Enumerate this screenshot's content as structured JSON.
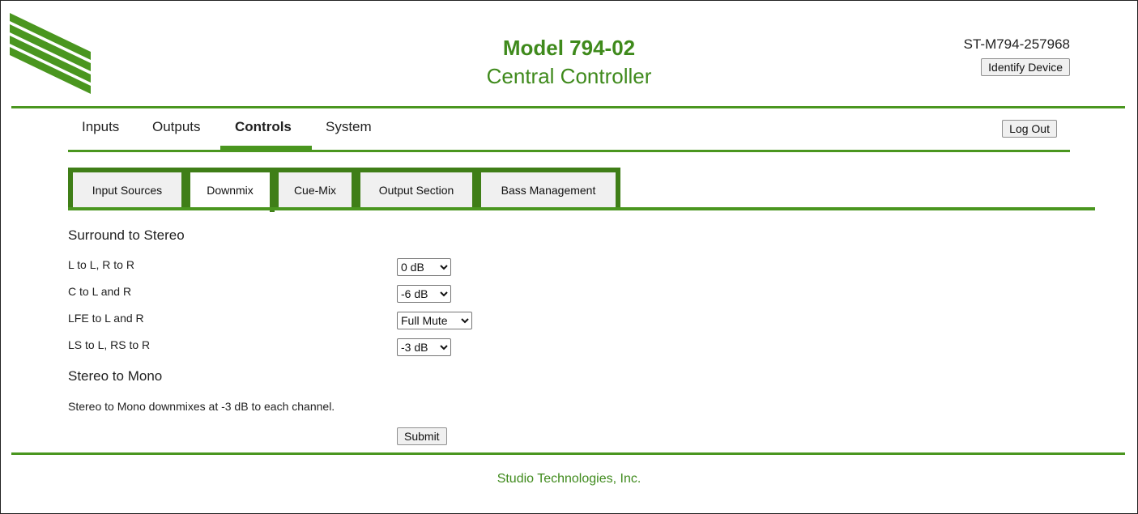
{
  "header": {
    "model": "Model 794-02",
    "subtitle": "Central Controller",
    "serial": "ST-M794-257968",
    "identify_label": "Identify Device"
  },
  "nav": {
    "items": [
      {
        "label": "Inputs"
      },
      {
        "label": "Outputs"
      },
      {
        "label": "Controls",
        "active": true
      },
      {
        "label": "System"
      }
    ],
    "logout_label": "Log Out"
  },
  "tabs": [
    {
      "label": "Input Sources"
    },
    {
      "label": "Downmix",
      "active": true
    },
    {
      "label": "Cue-Mix"
    },
    {
      "label": "Output Section"
    },
    {
      "label": "Bass Management"
    }
  ],
  "sections": {
    "surround": "Surround to Stereo",
    "mono": "Stereo to Mono"
  },
  "rows": [
    {
      "label": "L to L, R to R",
      "value": "0 dB"
    },
    {
      "label": "C to L and R",
      "value": "-6 dB"
    },
    {
      "label": "LFE to L and R",
      "value": "Full Mute"
    },
    {
      "label": "LS to L, RS to R",
      "value": "-3 dB"
    }
  ],
  "note": "Stereo to Mono downmixes at -3 dB to each channel.",
  "submit_label": "Submit",
  "footer": "Studio Technologies, Inc.",
  "colors": {
    "brand_green": "#3f8a1c",
    "tab_border": "#3f7e17"
  }
}
